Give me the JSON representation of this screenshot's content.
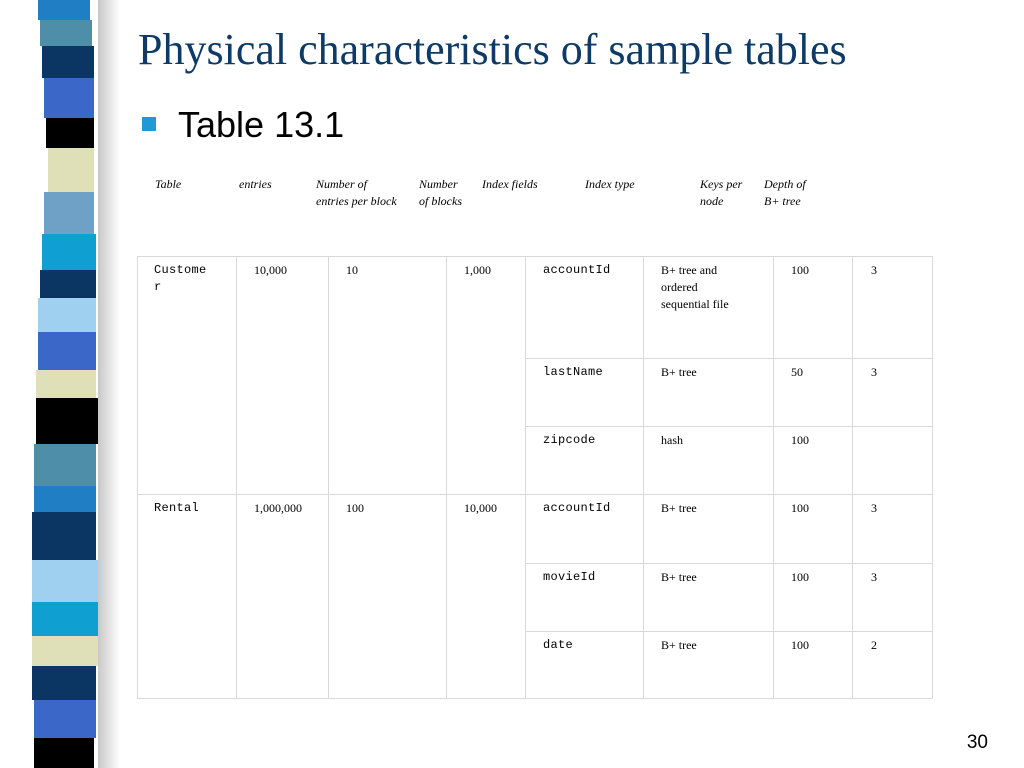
{
  "slide": {
    "title": "Physical characteristics of sample tables",
    "bullet": "Table 13.1",
    "page_number": "30"
  },
  "colors": {
    "title": "#0d3a66",
    "bullet": "#1e9ad6",
    "strip": [
      "#1f7ec4",
      "#4e8ea8",
      "#0b3563",
      "#3b68c8",
      "#000000",
      "#e0e0b8",
      "#6fa0c6",
      "#0f9fd0",
      "#9fd0f0"
    ]
  },
  "header": {
    "table": "Table",
    "entries": "entries",
    "per_block_1": "Number of",
    "per_block_2": "entries per block",
    "blocks_1": "Number",
    "blocks_2": "of blocks",
    "index_fields": "Index fields",
    "index_type": "Index type",
    "keys_1": "Keys per",
    "keys_2": "node",
    "depth_1": "Depth of",
    "depth_2": "B+ tree"
  },
  "rows": [
    {
      "table_1": "Custome",
      "table_2": "r",
      "entries": "10,000",
      "per_block": "10",
      "blocks": "1,000",
      "indexes": [
        {
          "field": "accountId",
          "type_1": "B+ tree and",
          "type_2": "ordered",
          "type_3": "sequential file",
          "keys": "100",
          "depth": "3"
        },
        {
          "field": "lastName",
          "type_1": "B+ tree",
          "keys": "50",
          "depth": "3"
        },
        {
          "field": "zipcode",
          "type_1": "hash",
          "keys": "100",
          "depth": ""
        }
      ]
    },
    {
      "table_1": "Rental",
      "entries": "1,000,000",
      "per_block": "100",
      "blocks": "10,000",
      "indexes": [
        {
          "field": "accountId",
          "type_1": "B+ tree",
          "keys": "100",
          "depth": "3"
        },
        {
          "field": "movieId",
          "type_1": "B+ tree",
          "keys": "100",
          "depth": "3"
        },
        {
          "field": "date",
          "type_1": "B+ tree",
          "keys": "100",
          "depth": "2"
        }
      ]
    }
  ]
}
